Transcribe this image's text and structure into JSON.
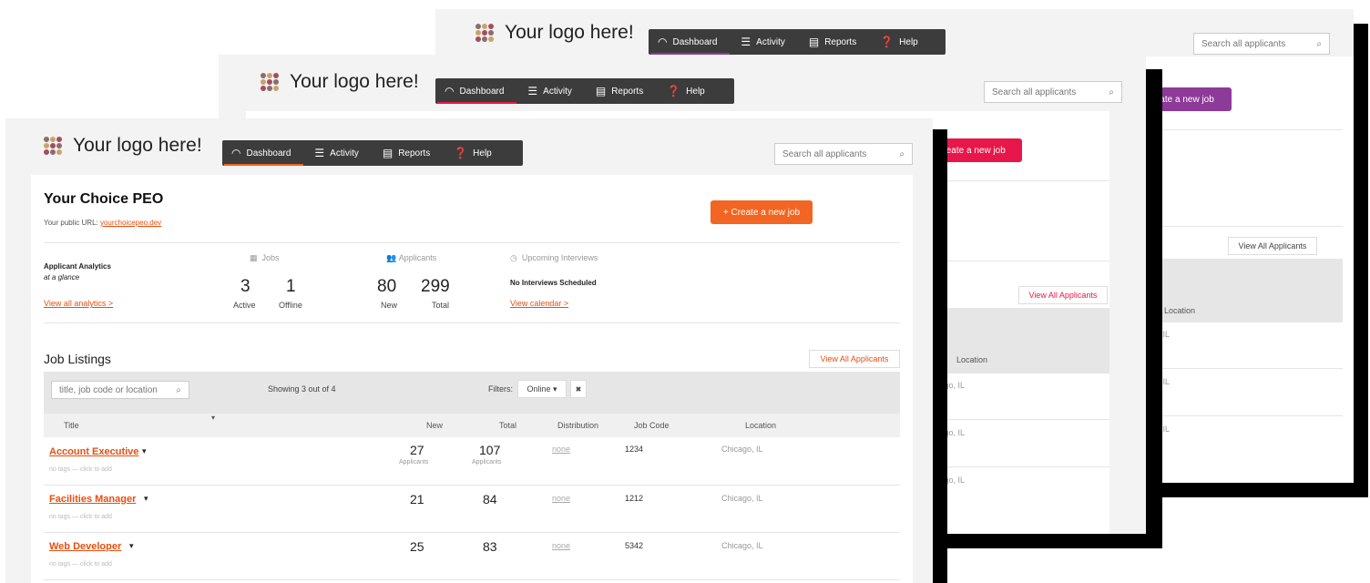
{
  "logo_text": "Your logo here!",
  "nav": {
    "dashboard": "Dashboard",
    "activity": "Activity",
    "reports": "Reports",
    "help": "Help"
  },
  "search_placeholder": "Search all applicants",
  "create_job_label": "+ Create a new job",
  "create_job_label_cropped": "Create a new job",
  "view_all_applicants": "View All Applicants",
  "colors": {
    "accent_front": "#f26522",
    "accent_mid": "#e8174b",
    "accent_back": "#8e3a99",
    "logo_dots": [
      "#8a6d6d",
      "#c9a36a",
      "#a74c5d"
    ]
  },
  "company": {
    "name": "Your Choice PEO",
    "public_url_label": "Your public URL:",
    "public_url": "yourchoicepeo.dev"
  },
  "analytics": {
    "title": "Applicant Analytics",
    "subtitle": "at a glance",
    "view_link": "View all analytics >"
  },
  "jobs": {
    "header": "Jobs",
    "active_value": "3",
    "active_label": "Active",
    "offline_value": "1",
    "offline_label": "Offline"
  },
  "applicants": {
    "header": "Applicants",
    "new_value": "80",
    "new_label": "New",
    "total_value": "299",
    "total_label": "Total"
  },
  "interviews": {
    "header": "Upcoming Interviews",
    "status": "No Interviews Scheduled",
    "link": "View calendar >"
  },
  "listings": {
    "title": "Job Listings",
    "search_placeholder": "title, job code or location",
    "showing": "Showing 3 out of 4",
    "filters_label": "Filters:",
    "filter_value": "Online ▾",
    "clear_icon_text": "✖",
    "columns": {
      "title": "Title",
      "new": "New",
      "total": "Total",
      "distribution": "Distribution",
      "job_code": "Job Code",
      "location": "Location"
    },
    "rows": [
      {
        "title": "Account Executive",
        "tags": "no tags — click to add",
        "new": "27",
        "new_sub": "Applicants",
        "total": "107",
        "total_sub": "Applicants",
        "distribution": "none",
        "code": "1234",
        "location": "Chicago, IL"
      },
      {
        "title": "Facilities Manager",
        "tags": "no tags — click to add",
        "new": "21",
        "new_sub": "",
        "total": "84",
        "total_sub": "",
        "distribution": "none",
        "code": "1212",
        "location": "Chicago, IL"
      },
      {
        "title": "Web Developer",
        "tags": "no tags — click to add",
        "new": "25",
        "new_sub": "",
        "total": "83",
        "total_sub": "",
        "distribution": "none",
        "code": "5342",
        "location": "Chicago, IL"
      }
    ]
  },
  "behind": {
    "location_header": "Location",
    "location_cell_mid": "icago, IL",
    "location_cell_back": "icago, IL"
  }
}
